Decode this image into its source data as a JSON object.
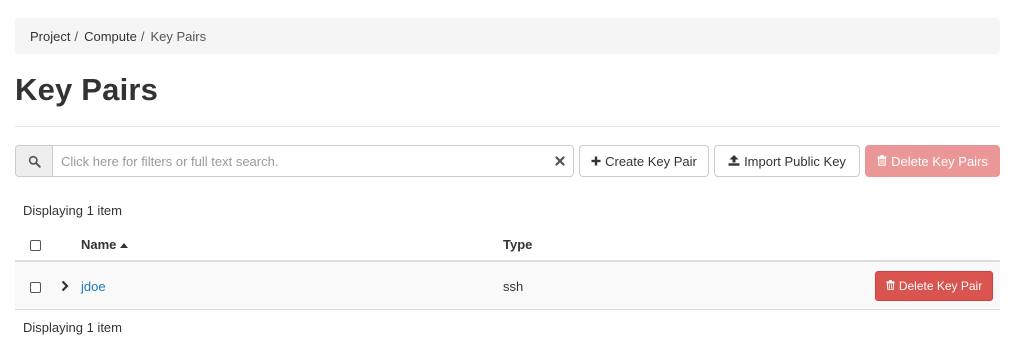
{
  "breadcrumb": {
    "items": [
      "Project",
      "Compute",
      "Key Pairs"
    ],
    "separator": "/"
  },
  "page": {
    "title": "Key Pairs"
  },
  "toolbar": {
    "search_placeholder": "Click here for filters or full text search.",
    "search_value": "",
    "create_label": "Create Key Pair",
    "import_label": "Import Public Key",
    "delete_multi_label": "Delete Key Pairs"
  },
  "table": {
    "count_label": "Displaying 1 item",
    "columns": {
      "name": "Name",
      "type": "Type"
    },
    "rows": [
      {
        "name": "jdoe",
        "type": "ssh",
        "action": "Delete Key Pair"
      }
    ]
  },
  "colors": {
    "link": "#1a7ab9",
    "danger": "#d9534f",
    "danger_disabled": "#eb9797"
  },
  "icons": {
    "search": "search-icon",
    "clear": "close-icon",
    "create": "plus-icon",
    "import": "upload-icon",
    "delete": "trash-icon",
    "sort": "sort-up-icon",
    "expand": "chevron-right-icon"
  }
}
